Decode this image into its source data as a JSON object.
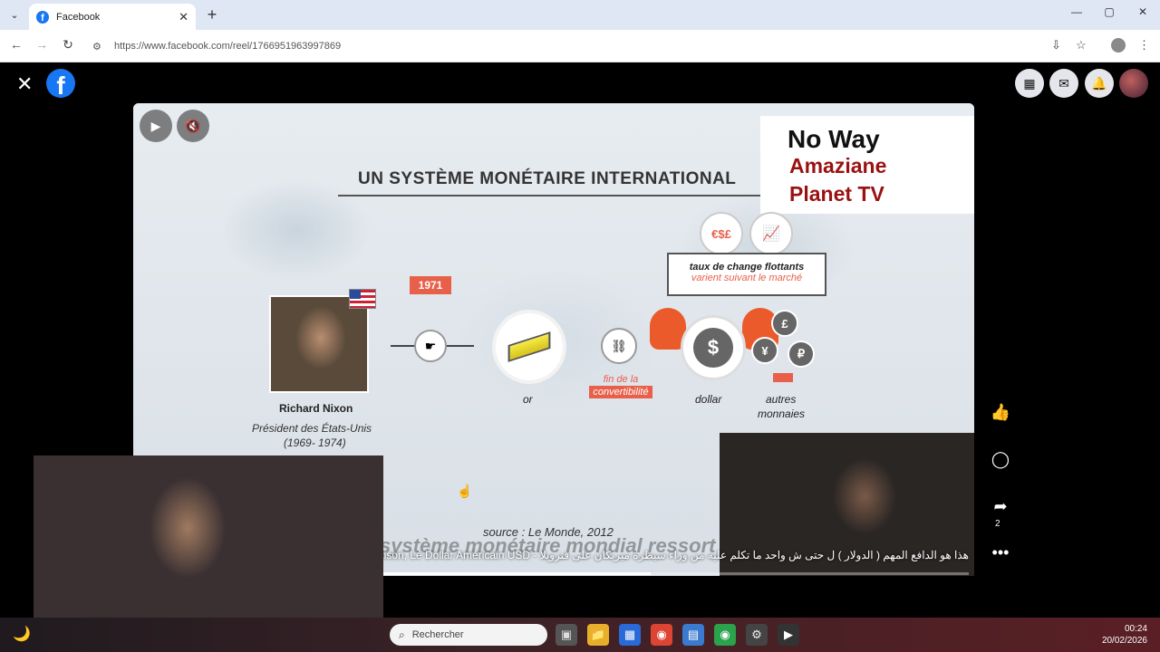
{
  "browser": {
    "tab_title": "Facebook",
    "url": "https://www.facebook.com/reel/1766951963997869",
    "new_tab": "+",
    "tab_close": "✕",
    "win_min": "—",
    "win_max": "▢",
    "win_close": "✕"
  },
  "facebook": {
    "logo_letter": "f",
    "close": "✕"
  },
  "slide": {
    "title": "UN SYSTÈME MONÉTAIRE INTERNATIONAL",
    "brand_line1": "No Way",
    "brand_line2": "Amaziane",
    "brand_line3": "Planet TV",
    "year": "1971",
    "person_name": "Richard Nixon",
    "person_role": "Président des États-Unis",
    "person_years": "(1969- 1974)",
    "or_label": "or",
    "fin_line1": "fin de la",
    "fin_line2": "convertibilité",
    "dollar_label": "dollar",
    "autres_label": "autres",
    "monnaies_label": "monnaies",
    "taux_line1": "taux de change flottants",
    "taux_line2": "varient suivant le marché",
    "source": "source : Le Monde, 2012",
    "ghost_subtitle": "système monétaire mondial ressort c"
  },
  "reel": {
    "caption": "هذا هو الدافع المهم ( الدولار ) ل حتى ش واحد ما تكلم عليه من وراء سيطرة ميريكان على فنزويلا - Raison, Le Dollar Américain USD",
    "progress": 0.46,
    "share_count": "2"
  },
  "taskbar": {
    "search_placeholder": "Rechercher",
    "time": "00:24",
    "date": "20/02/2026"
  },
  "colors": {
    "accent_orange": "#e8604a",
    "brand_red": "#9b1111",
    "fb_blue": "#1877f2"
  }
}
